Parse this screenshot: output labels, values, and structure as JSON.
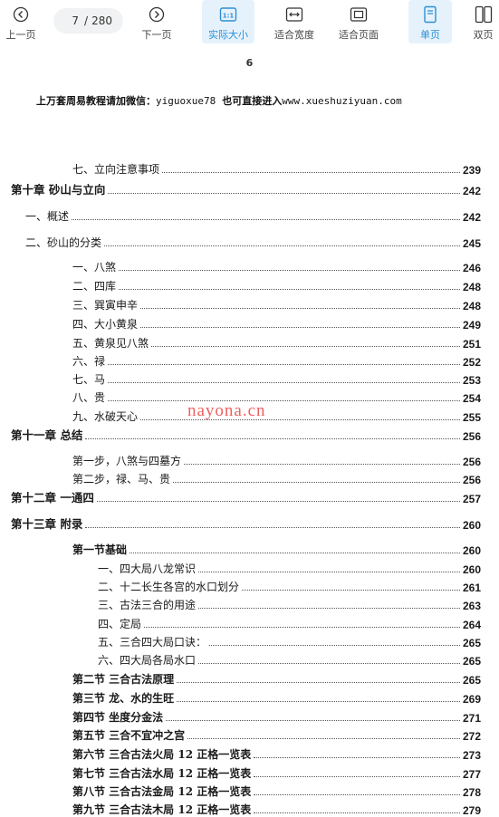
{
  "toolbar": {
    "prev_label": "上一页",
    "next_label": "下一页",
    "current_page": "7",
    "page_separator": "/",
    "total_pages": "280",
    "actual_size_label": "实际大小",
    "fit_width_label": "适合宽度",
    "fit_page_label": "适合页面",
    "single_page_label": "单页",
    "double_page_label": "双页",
    "accent_color": "#2b8fd6",
    "icons": [
      "chevron-left-icon",
      "chevron-right-icon",
      "actual-size-icon",
      "fit-width-icon",
      "fit-page-icon",
      "single-page-icon",
      "double-page-icon"
    ]
  },
  "document": {
    "page_number": "6",
    "banner_text": "上万套周易教程请加微信：",
    "banner_wechat": "yiguoxue78",
    "banner_text2": "也可直接进入",
    "banner_url": "www.xueshuziyuan.com",
    "watermark": "nayona.cn",
    "toc": [
      {
        "title": "七、立向注意事项",
        "page": "239"
      },
      {
        "title": "第十章  砂山与立向",
        "page": "242"
      },
      {
        "title": "一、概述",
        "page": "242"
      },
      {
        "title": "二、砂山的分类",
        "page": "245"
      },
      {
        "title": "一、八煞",
        "page": "246"
      },
      {
        "title": "二、四库",
        "page": "248"
      },
      {
        "title": "三、巽寅申辛",
        "page": "248"
      },
      {
        "title": "四、大小黄泉",
        "page": "249"
      },
      {
        "title": "五、黄泉见八煞",
        "page": "251"
      },
      {
        "title": "六、禄",
        "page": "252"
      },
      {
        "title": "七、马",
        "page": "253"
      },
      {
        "title": "八、贵",
        "page": "254"
      },
      {
        "title": "九、水破天心",
        "page": "255"
      },
      {
        "title": "第十一章  总结",
        "page": "256"
      },
      {
        "title": "第一步，八煞与四墓方",
        "page": "256"
      },
      {
        "title": "第二步，禄、马、贵",
        "page": "256"
      },
      {
        "title": "第十二章  一通四",
        "page": "257"
      },
      {
        "title": "第十三章  附录",
        "page": "260"
      },
      {
        "title": "第一节基础",
        "page": "260"
      },
      {
        "title": "一、四大局八龙常识",
        "page": "260"
      },
      {
        "title": "二、十二长生各宫的水口划分",
        "page": "261"
      },
      {
        "title": "三、古法三合的用途",
        "page": "263"
      },
      {
        "title": "四、定局",
        "page": "264"
      },
      {
        "title": "五、三合四大局口诀：",
        "page": "265"
      },
      {
        "title": "六、四大局各局水口",
        "page": "265"
      },
      {
        "title": "第二节  三合古法原理",
        "page": "265"
      },
      {
        "title": "第三节  龙、水的生旺",
        "page": "269"
      },
      {
        "title": "第四节  坐度分金法",
        "page": "271"
      },
      {
        "title": "第五节  三合不宜冲之宫",
        "page": "272"
      },
      {
        "title": "第六节  三合古法火局  12 正格一览表",
        "page": "273"
      },
      {
        "title": "第七节  三合古法水局  12 正格一览表",
        "page": "277"
      },
      {
        "title": "第八节  三合古法金局  12 正格一览表",
        "page": "278"
      },
      {
        "title": "第九节  三合古法木局  12 正格一览表",
        "page": "279"
      }
    ]
  }
}
